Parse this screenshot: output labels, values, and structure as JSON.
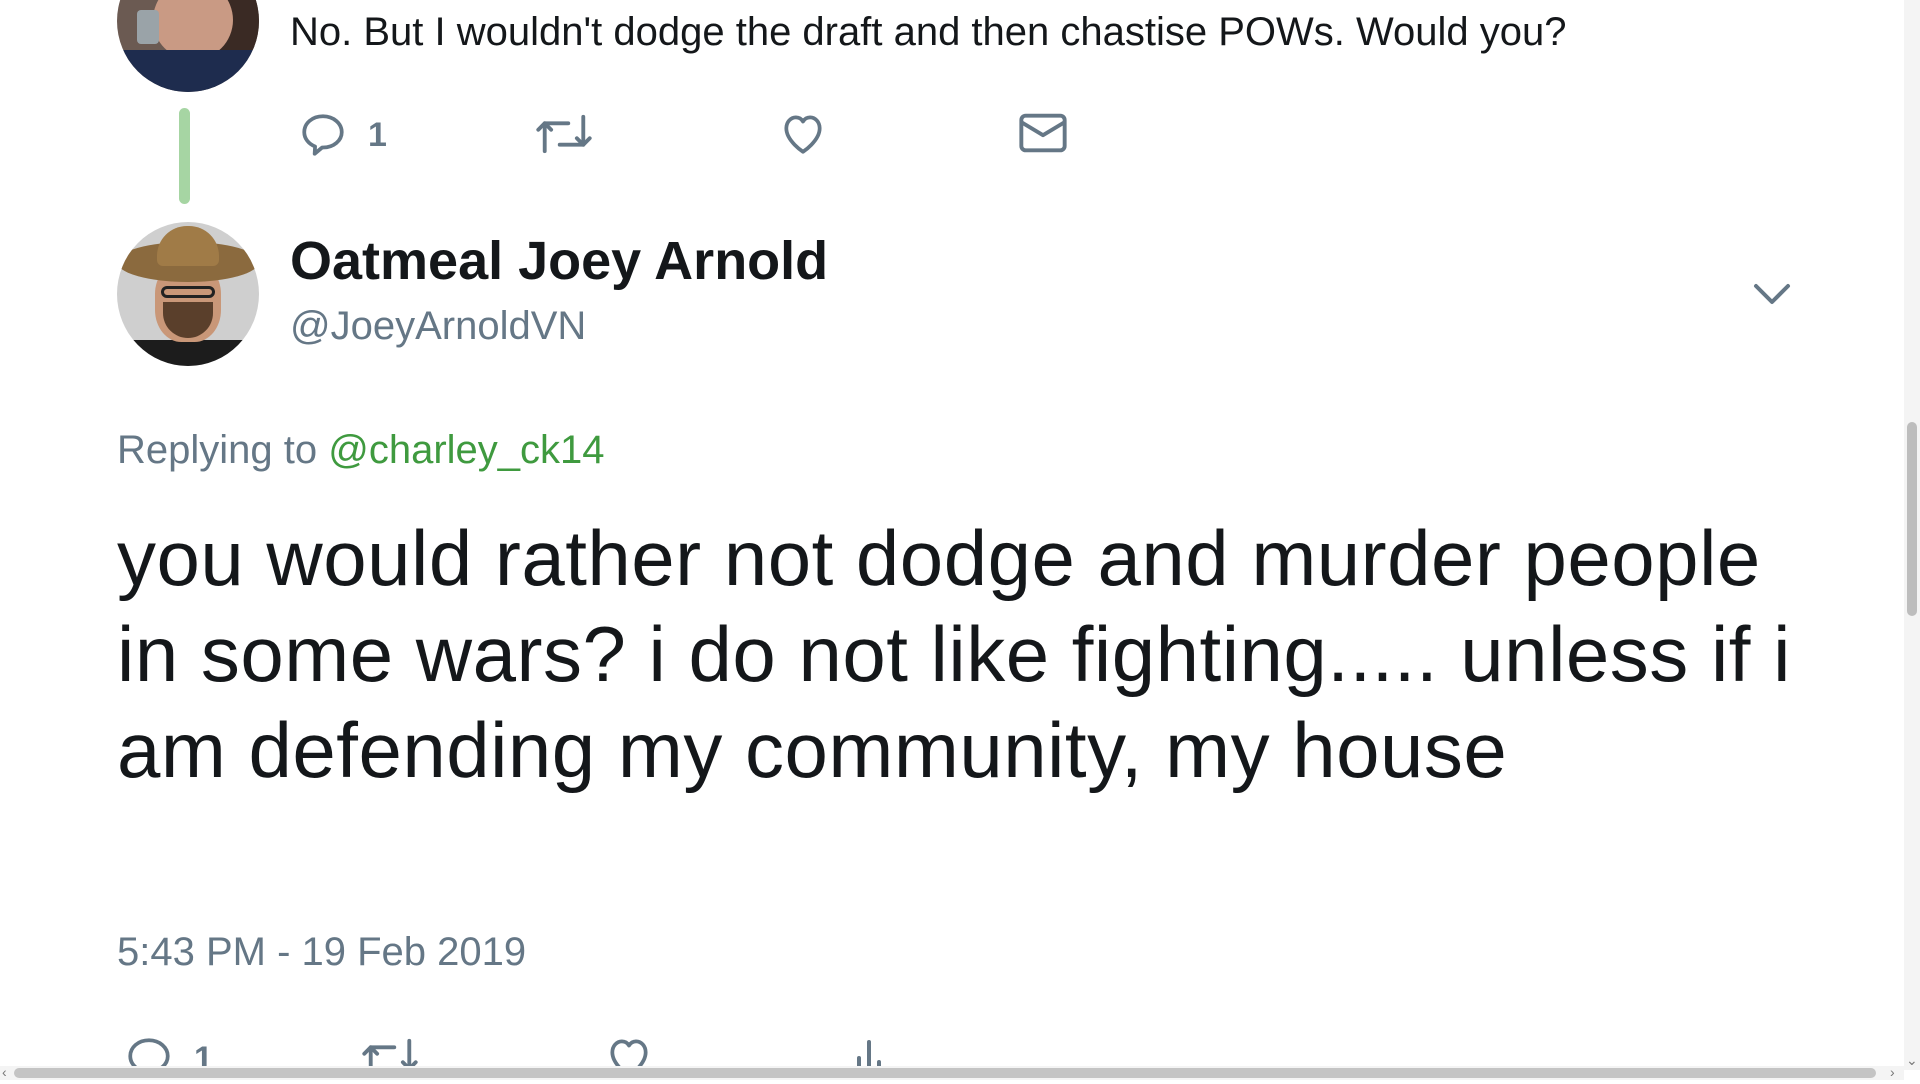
{
  "previous_tweet": {
    "text": "No. But I wouldn't dodge the draft and then chastise POWs. Would you?",
    "actions": {
      "reply_count": "1",
      "reply_icon": "reply-icon",
      "retweet_icon": "retweet-icon",
      "like_icon": "heart-icon",
      "message_icon": "envelope-icon"
    }
  },
  "tweet": {
    "display_name": "Oatmeal Joey Arnold",
    "handle": "@JoeyArnoldVN",
    "replying_prefix": "Replying to",
    "replying_mention": "@charley_ck14",
    "body": "you would rather not dodge and murder people in some wars? i do not like fighting..... unless if i am defending my community, my house",
    "timestamp": "5:43 PM - 19 Feb 2019",
    "actions": {
      "reply_count": "1",
      "reply_icon": "reply-icon",
      "retweet_icon": "retweet-icon",
      "like_icon": "heart-icon",
      "analytics_icon": "analytics-icon"
    }
  },
  "colors": {
    "text": "#14171a",
    "secondary": "#657786",
    "mention": "#3f9a3f",
    "thread_line": "#a6d5a3"
  }
}
